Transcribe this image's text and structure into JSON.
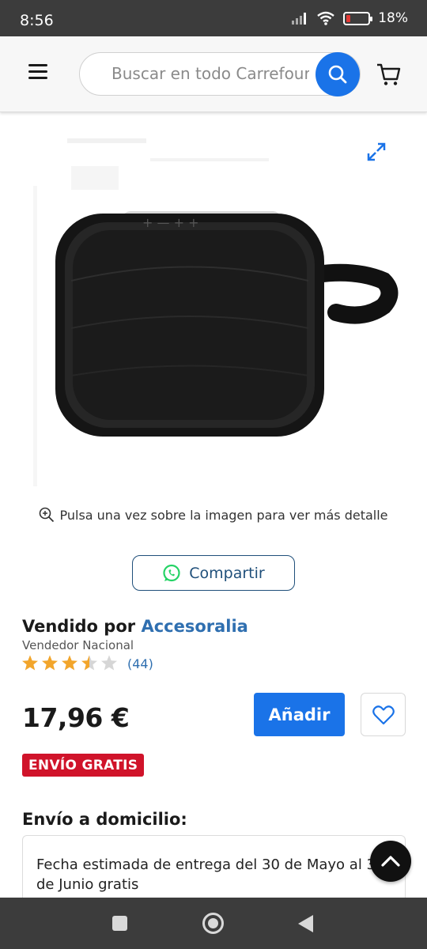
{
  "status_bar": {
    "time": "8:56",
    "battery_percent": "18%"
  },
  "header": {
    "search_placeholder": "Buscar en todo Carrefour",
    "icons": [
      "menu-icon",
      "search-icon",
      "cart-icon"
    ]
  },
  "product": {
    "image_alt": "Altavoz portátil negro",
    "zoom_hint": "Pulsa una vez sobre la imagen para ver más detalle",
    "share_label": "Compartir",
    "sold_by_prefix": "Vendido por",
    "seller_name": "Accesoralia",
    "seller_type": "Vendedor Nacional",
    "rating_value": 3.5,
    "rating_max": 5,
    "rating_count": "(44)",
    "price": "17,96 €",
    "add_label": "Añadir",
    "free_shipping_badge": "ENVÍO GRATIS"
  },
  "delivery": {
    "title": "Envío a domicilio:",
    "estimate": "Fecha estimada de entrega del 30 de Mayo al 3 de Junio gratis"
  },
  "colors": {
    "accent_blue": "#1a73e8",
    "seller_link": "#2f6fb0",
    "free_badge": "#d0132a",
    "star": "#f2a52b",
    "whatsapp": "#25d366"
  }
}
